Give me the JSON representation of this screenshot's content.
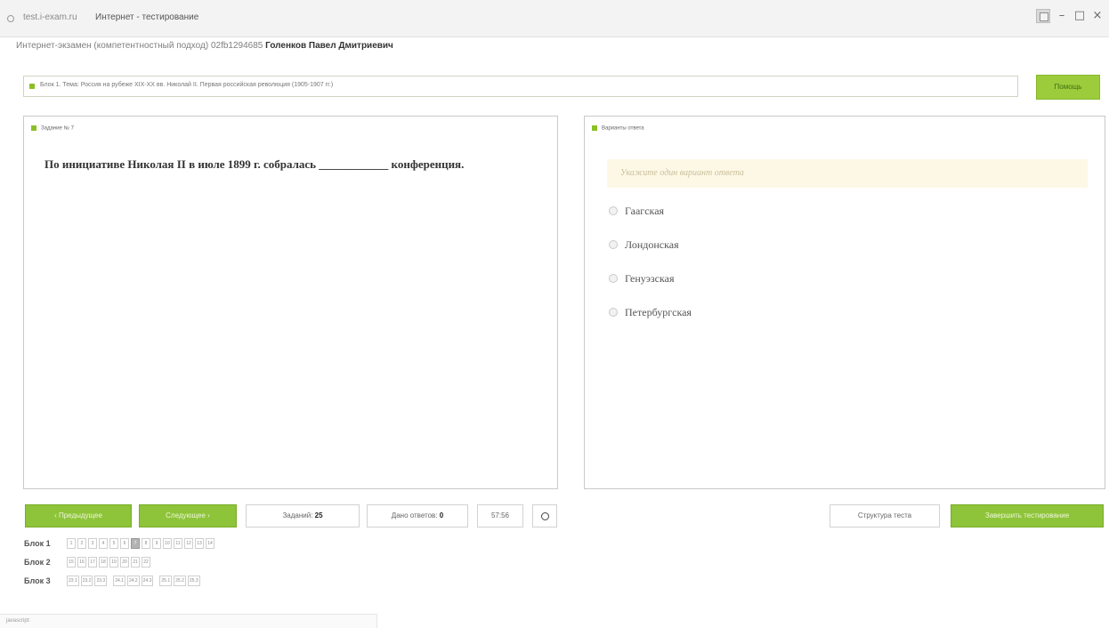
{
  "window": {
    "url": "test.i-exam.ru",
    "title": "Интернет - тестирование"
  },
  "exam": {
    "prefix": "Интернет-экзамен (компетентностный подход) 02fb1294685",
    "student": "Голенков Павел Дмитриевич"
  },
  "topic": {
    "text": "Блок 1. Тема: Россия на рубеже XIX-XX вв. Николай II. Первая российская революция (1905-1907 гг.)",
    "help_label": "Помощь"
  },
  "question": {
    "header": "Задание № 7",
    "text": "По инициативе Николая II в июле 1899 г. собралась ____________ конференция."
  },
  "answers": {
    "header": "Варианты ответа",
    "hint": "Укажите один вариант ответа",
    "options": [
      "Гаагская",
      "Лондонская",
      "Генуэзская",
      "Петербургская"
    ]
  },
  "footer": {
    "prev_label": "‹ Предыдущее",
    "next_label": "Следующее ›",
    "tasks_label": "Заданий:",
    "tasks_value": "25",
    "answered_label": "Дано ответов:",
    "answered_value": "0",
    "timer": "57:56",
    "structure_label": "Структура теста",
    "finish_label": "Завершить тестирование"
  },
  "blocks": [
    {
      "label": "Блок 1",
      "groups": [
        [
          "1",
          "2",
          "3",
          "4",
          "5",
          "6",
          "7",
          "8",
          "9",
          "10",
          "11",
          "12",
          "13",
          "14"
        ]
      ],
      "current": "7"
    },
    {
      "label": "Блок 2",
      "groups": [
        [
          "15",
          "16",
          "17",
          "18",
          "19",
          "20",
          "21",
          "22"
        ]
      ],
      "current": ""
    },
    {
      "label": "Блок 3",
      "groups": [
        [
          "23.1",
          "23.2",
          "23.3"
        ],
        [
          "24.1",
          "24.2",
          "24.3"
        ],
        [
          "25.1",
          "25.2",
          "25.3"
        ]
      ],
      "current": ""
    }
  ],
  "status": {
    "text": "javascript:"
  }
}
